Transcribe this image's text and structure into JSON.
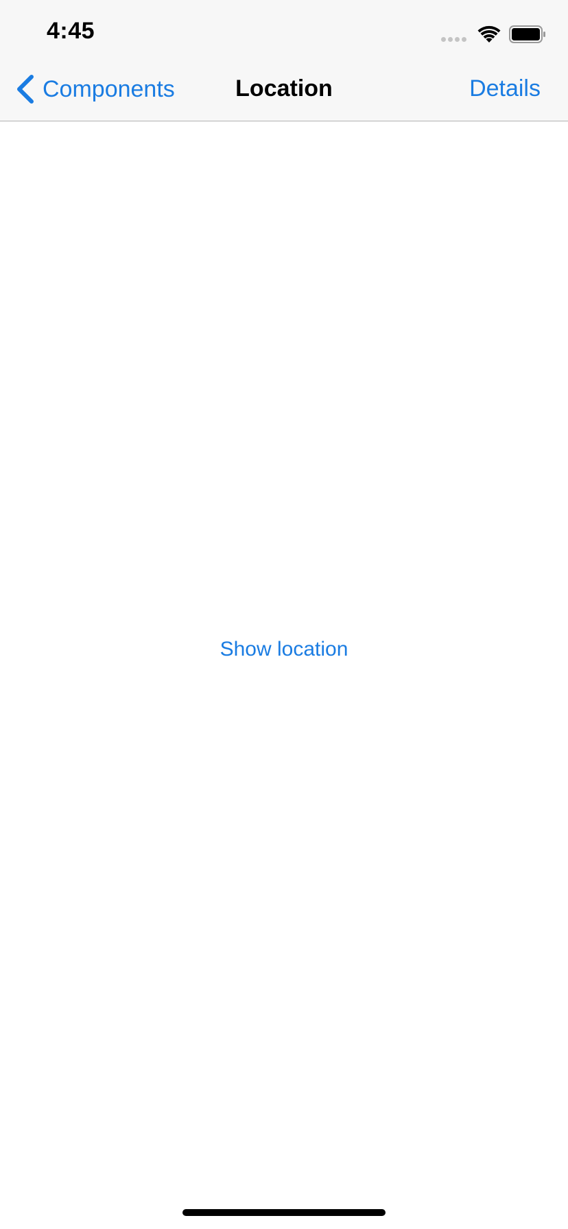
{
  "status_bar": {
    "time": "4:45",
    "icons": [
      "cellular-signal-icon",
      "wifi-icon",
      "battery-icon"
    ]
  },
  "nav_bar": {
    "back_label": "Components",
    "title": "Location",
    "right_label": "Details"
  },
  "content": {
    "show_location_label": "Show location"
  },
  "colors": {
    "accent": "#1a7ce2",
    "nav_background": "#f7f7f7",
    "separator": "#b2b2b2"
  }
}
